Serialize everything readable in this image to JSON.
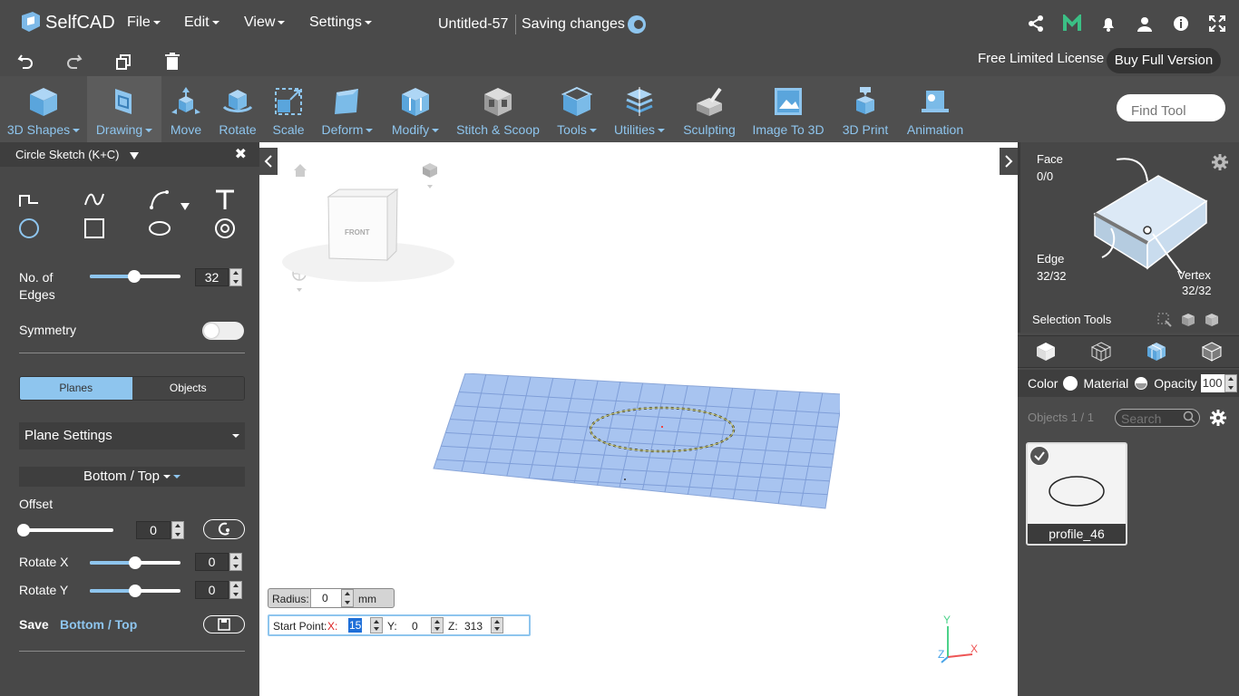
{
  "app": {
    "name": "SelfCAD"
  },
  "menu": {
    "file": "File",
    "edit": "Edit",
    "view": "View",
    "settings": "Settings"
  },
  "document": {
    "title": "Untitled-57",
    "status": "Saving changes"
  },
  "license": {
    "label": "Free Limited License",
    "buy": "Buy Full Version"
  },
  "toolbar": {
    "items": [
      {
        "label": "3D Shapes",
        "icon": "cube-icon"
      },
      {
        "label": "Drawing",
        "icon": "drawing-icon"
      },
      {
        "label": "Move",
        "icon": "move-icon"
      },
      {
        "label": "Rotate",
        "icon": "rotate-icon"
      },
      {
        "label": "Scale",
        "icon": "scale-icon"
      },
      {
        "label": "Deform",
        "icon": "deform-icon"
      },
      {
        "label": "Modify",
        "icon": "modify-icon"
      },
      {
        "label": "Stitch & Scoop",
        "icon": "stitch-scoop-icon"
      },
      {
        "label": "Tools",
        "icon": "tools-icon"
      },
      {
        "label": "Utilities",
        "icon": "utilities-icon"
      },
      {
        "label": "Sculpting",
        "icon": "sculpting-icon"
      },
      {
        "label": "Image To 3D",
        "icon": "image-to-3d-icon"
      },
      {
        "label": "3D Print",
        "icon": "3d-print-icon"
      },
      {
        "label": "Animation",
        "icon": "animation-icon"
      }
    ],
    "find_placeholder": "Find Tool"
  },
  "panel": {
    "title": "Circle Sketch (K+C)",
    "edges_label_1": "No. of",
    "edges_label_2": "Edges",
    "edges_value": "32",
    "edges_fraction": 0.5,
    "symmetry_label": "Symmetry",
    "symmetry_on": false,
    "tab_planes": "Planes",
    "tab_objects": "Objects",
    "plane_settings": "Plane Settings",
    "plane_orientation": "Bottom / Top",
    "offset_label": "Offset",
    "offset_value": "0",
    "rotate_x_label": "Rotate X",
    "rotate_x_value": "0",
    "rotate_y_label": "Rotate Y",
    "rotate_y_value": "0",
    "save_label": "Save",
    "save_plane": "Bottom / Top"
  },
  "viewport": {
    "cube_face": "FRONT",
    "radius_label": "Radius:",
    "radius_value": "0",
    "radius_unit": "mm",
    "start_label": "Start Point:",
    "x_label": "X:",
    "x_value": "15",
    "y_label": "Y:",
    "y_value": "0",
    "z_label": "Z:",
    "z_value": "313",
    "axis_x": "X",
    "axis_y": "Y",
    "axis_z": "Z"
  },
  "selection": {
    "face_label": "Face",
    "face_value": "0/0",
    "edge_label": "Edge",
    "edge_value": "32/32",
    "vertex_label": "Vertex",
    "vertex_value": "32/32",
    "tools_label": "Selection Tools"
  },
  "appearance": {
    "color": "Color",
    "material": "Material",
    "opacity": "Opacity",
    "opacity_value": "100"
  },
  "objects": {
    "count_label": "Objects 1 / 1",
    "search_placeholder": "Search",
    "items": [
      {
        "name": "profile_46"
      }
    ]
  },
  "colors": {
    "accent": "#8ec5ee",
    "toolbar_bg": "#4f4f4f",
    "panel_bg": "#484848",
    "plane": "#a8c4f0"
  }
}
